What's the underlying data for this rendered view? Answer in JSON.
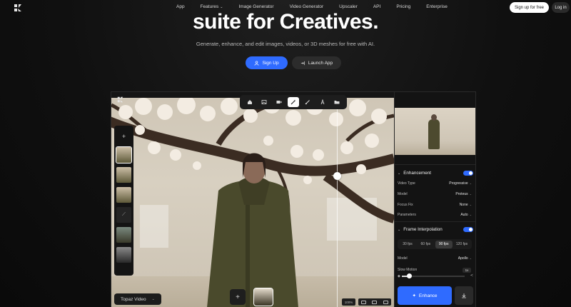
{
  "nav": {
    "links": [
      {
        "label": "App",
        "dropdown": false
      },
      {
        "label": "Features",
        "dropdown": true
      },
      {
        "label": "Image Generator",
        "dropdown": false
      },
      {
        "label": "Video Generator",
        "dropdown": false
      },
      {
        "label": "Upscaler",
        "dropdown": false
      },
      {
        "label": "API",
        "dropdown": false
      },
      {
        "label": "Pricing",
        "dropdown": false
      },
      {
        "label": "Enterprise",
        "dropdown": false
      }
    ],
    "signup_label": "Sign up for free",
    "login_label": "Log in"
  },
  "hero": {
    "title": "suite for Creatives.",
    "subtitle": "Generate, enhance, and edit images, videos, or 3D meshes for free with AI.",
    "primary_cta": "Sign Up",
    "secondary_cta": "Launch App"
  },
  "editor": {
    "toolbar_tools": [
      "home-icon",
      "image-icon",
      "video-icon",
      "magic-wand-icon",
      "brush-icon",
      "text-icon",
      "folder-icon"
    ],
    "active_tool": "magic-wand-icon",
    "badge_label": "Topaz Video",
    "zoom_label": "100%"
  },
  "panel": {
    "enhancement": {
      "label": "Enhancement",
      "enabled": true,
      "rows": [
        {
          "label": "Video Type",
          "value": "Progressive"
        },
        {
          "label": "Model",
          "value": "Proteus"
        },
        {
          "label": "Focus Fix",
          "value": "None"
        },
        {
          "label": "Parameters",
          "value": "Auto"
        }
      ]
    },
    "frame_interpolation": {
      "label": "Frame Interpolation",
      "enabled": true,
      "fps_options": [
        "30 fps",
        "60 fps",
        "90 fps",
        "120 fps"
      ],
      "selected_fps": "90 fps",
      "model_label": "Model",
      "model_value": "Apollo",
      "slow_motion_label": "Slow Motion",
      "slow_motion_value": "1x",
      "slider_value": 0.12
    },
    "enhance_button": "Enhance"
  },
  "colors": {
    "accent": "#2f6bff",
    "background": "#101010",
    "panel": "#131313"
  }
}
